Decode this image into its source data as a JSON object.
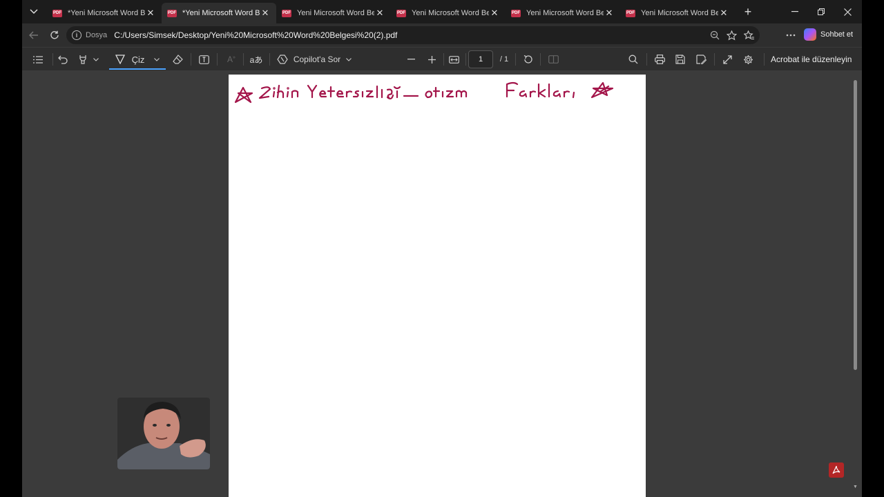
{
  "tabs": [
    {
      "title": "*Yeni Microsoft Word Belgesi",
      "active": false
    },
    {
      "title": "*Yeni Microsoft Word Belgesi",
      "active": true
    },
    {
      "title": "Yeni Microsoft Word Belgesi",
      "active": false
    },
    {
      "title": "Yeni Microsoft Word Belgesi",
      "active": false
    },
    {
      "title": "Yeni Microsoft Word Belgesi",
      "active": false
    },
    {
      "title": "Yeni Microsoft Word Belgesi",
      "active": false
    }
  ],
  "tab_icon_text": "PDF",
  "address": {
    "scheme_label": "Dosya",
    "url": "C:/Users/Simsek/Desktop/Yeni%20Microsoft%20Word%20Belgesi%20(2).pdf"
  },
  "copilot_label": "Sohbet et",
  "toolbar": {
    "draw_label": "Çiz",
    "copilot_ask_label": "Copilot'a Sor",
    "page_current": "1",
    "page_total": "/ 1",
    "acrobat_label": "Acrobat ile düzenleyin"
  },
  "handwriting": {
    "text": "Zihin Yetersizliği – otizm Farkları",
    "ink_color": "#a3154a"
  },
  "colors": {
    "accent": "#4aa3ff",
    "pdf_badge": "#c4314b"
  }
}
